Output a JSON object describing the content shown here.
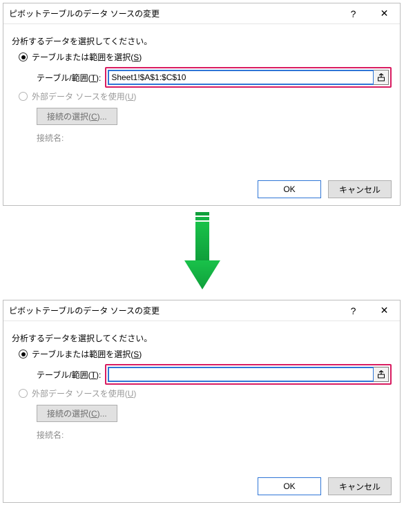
{
  "dialog": {
    "title": "ピボットテーブルのデータ ソースの変更",
    "help_label": "?",
    "close_label": "✕",
    "select_prompt": "分析するデータを選択してください。",
    "radio_table_prefix": "テーブルまたは範囲を選択(",
    "radio_table_key": "S",
    "radio_table_suffix": ")",
    "range_label_prefix": "テーブル/範囲(",
    "range_label_key": "T",
    "range_label_suffix": "):",
    "radio_external_prefix": "外部データ ソースを使用(",
    "radio_external_key": "U",
    "radio_external_suffix": ")",
    "conn_button_prefix": "接続の選択(",
    "conn_button_key": "C",
    "conn_button_suffix": ")...",
    "conn_name_label": "接続名:",
    "ok": "OK",
    "cancel": "キャンセル",
    "range_value_before": "Sheet1!$A$1:$C$10",
    "range_value_after": ""
  },
  "highlight_color": "#d81b60"
}
